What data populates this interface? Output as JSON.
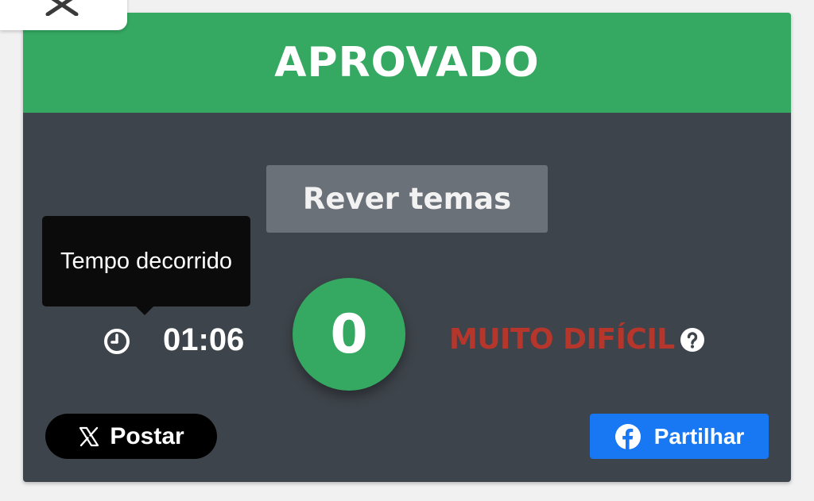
{
  "result": {
    "status_label": "APROVADO",
    "score": "0",
    "difficulty": "MUITO DIFÍCIL"
  },
  "review_button": {
    "label": "Rever temas"
  },
  "timer": {
    "tooltip": "Tempo decorrido",
    "elapsed": "01:06"
  },
  "share": {
    "post_label": "Postar",
    "share_label": "Partilhar"
  },
  "icons": {
    "close": "close-icon",
    "clock": "clock-icon",
    "help": "question-circle-icon",
    "x_logo": "x-logo-icon",
    "facebook": "facebook-icon"
  },
  "colors": {
    "success_green": "#35a862",
    "card_background": "#3e444b",
    "review_button": "#6a7179",
    "difficulty_red": "#b7362b",
    "facebook_blue": "#1877f2",
    "x_black": "#000000"
  }
}
